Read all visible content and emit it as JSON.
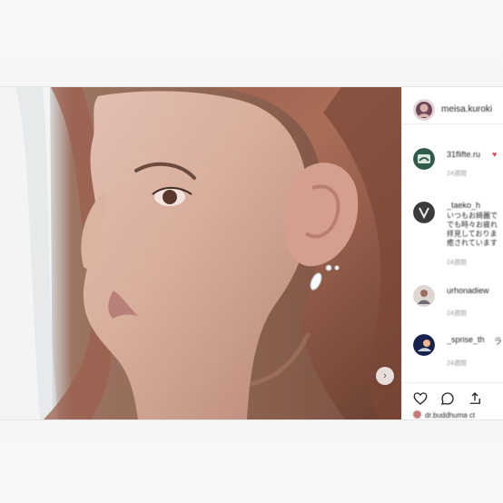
{
  "post": {
    "author": {
      "username": "meisa.kuroki"
    },
    "comments": [
      {
        "username": "31flifte.ru",
        "text": "♥",
        "meta": "24週間"
      },
      {
        "username": "_taeko_h",
        "lines": [
          "いつもお綺麗で",
          "でも時々お疲れ",
          "拝見しておりま",
          "癒されています"
        ],
        "meta": "24週間"
      },
      {
        "username": "urhonadiew",
        "meta": "24週間"
      },
      {
        "username": "_sprise_th",
        "text": "ラ",
        "meta": "24週間"
      }
    ],
    "liked_by": "dr.buddhuma ct"
  },
  "icons": {
    "next": "chevron-right-icon",
    "like": "heart-icon",
    "comment": "comment-icon",
    "share": "share-icon"
  },
  "colors": {
    "text": "#262626",
    "muted": "#999999",
    "heart_red": "#e14a5b",
    "border": "#efefef"
  }
}
